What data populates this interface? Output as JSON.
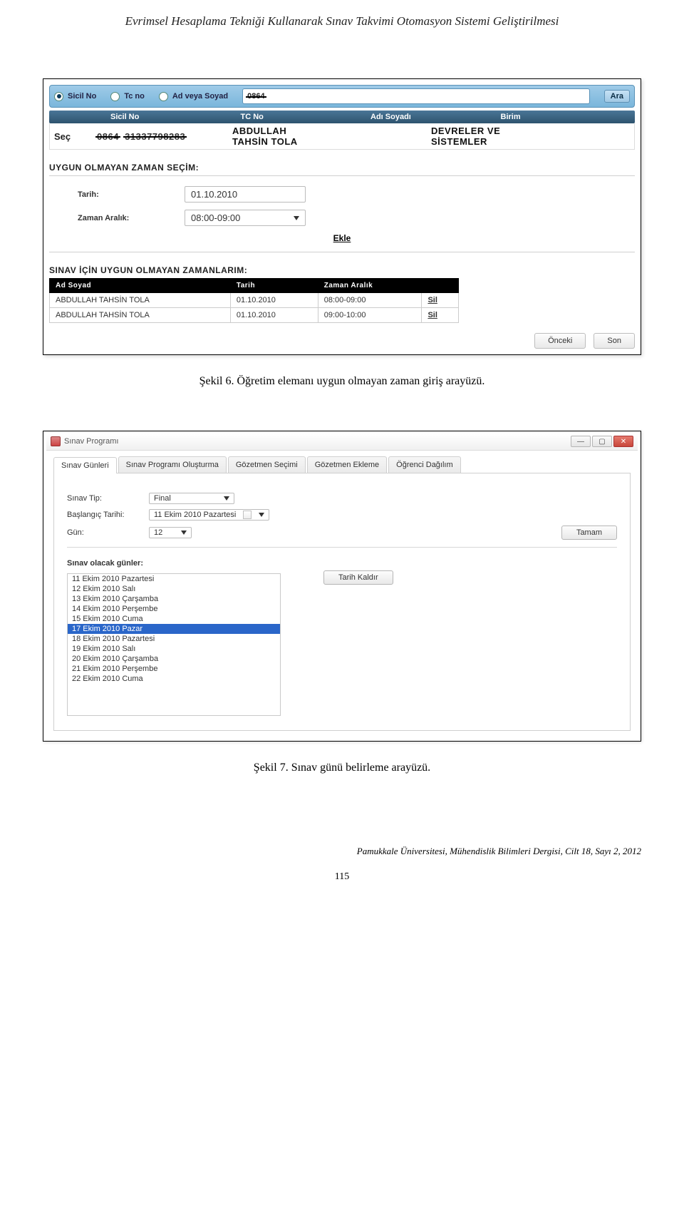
{
  "header": "Evrimsel Hesaplama Tekniği Kullanarak Sınav Takvimi Otomasyon Sistemi Geliştirilmesi",
  "fig6": {
    "caption": "Şekil 6. Öğretim elemanı uygun olmayan zaman giriş arayüzü.",
    "search": {
      "radios": [
        "Sicil No",
        "Tc no",
        "Ad veya Soyad"
      ],
      "value": "0864",
      "button": "Ara"
    },
    "result_header": {
      "col1": "",
      "col2": "Sicil No",
      "col3": "TC No",
      "col4": "Adı Soyadı",
      "col5": "Birim"
    },
    "result_row": {
      "sec": "Seç",
      "sicil": "0864",
      "tcno": "31337798283",
      "name1": "ABDULLAH",
      "name2": "TAHSİN TOLA",
      "birim1": "DEVRELER VE",
      "birim2": "SİSTEMLER"
    },
    "section1": "UYGUN OLMAYAN ZAMAN SEÇİM:",
    "fields": {
      "date_label": "Tarih:",
      "date_value": "01.10.2010",
      "range_label": "Zaman Aralık:",
      "range_value": "08:00-09:00"
    },
    "ekle": "Ekle",
    "section2": "SINAV İÇİN UYGUN OLMAYAN ZAMANLARIM:",
    "table_headers": [
      "Ad Soyad",
      "Tarih",
      "Zaman Aralık",
      ""
    ],
    "table_rows": [
      {
        "name": "ABDULLAH TAHSİN TOLA",
        "date": "01.10.2010",
        "range": "08:00-09:00",
        "action": "Sil"
      },
      {
        "name": "ABDULLAH TAHSİN TOLA",
        "date": "01.10.2010",
        "range": "09:00-10:00",
        "action": "Sil"
      }
    ],
    "nav": {
      "prev": "Önceki",
      "last": "Son"
    }
  },
  "fig7": {
    "caption": "Şekil 7. Sınav günü belirleme arayüzü.",
    "title": "Sınav Programı",
    "tabs": [
      "Sınav Günleri",
      "Sınav Programı Oluşturma",
      "Gözetmen Seçimi",
      "Gözetmen Ekleme",
      "Öğrenci Dağılım"
    ],
    "form": {
      "type_label": "Sınav Tip:",
      "type_value": "Final",
      "start_label": "Başlangıç Tarihi:",
      "start_value": "11   Ekim    2010  Pazartesi",
      "day_label": "Gün:",
      "day_value": "12",
      "ok": "Tamam"
    },
    "list_title": "Sınav olacak günler:",
    "days": [
      "11 Ekim 2010 Pazartesi",
      "12 Ekim 2010 Salı",
      "13 Ekim 2010 Çarşamba",
      "14 Ekim 2010 Perşembe",
      "15 Ekim 2010 Cuma",
      "17 Ekim 2010 Pazar",
      "18 Ekim 2010 Pazartesi",
      "19 Ekim 2010 Salı",
      "20 Ekim 2010 Çarşamba",
      "21 Ekim 2010 Perşembe",
      "22 Ekim 2010 Cuma"
    ],
    "selected_index": 5,
    "remove": "Tarih Kaldır"
  },
  "journal": "Pamukkale Üniversitesi, Mühendislik Bilimleri Dergisi, Cilt 18, Sayı 2, 2012",
  "pagenum": "115"
}
